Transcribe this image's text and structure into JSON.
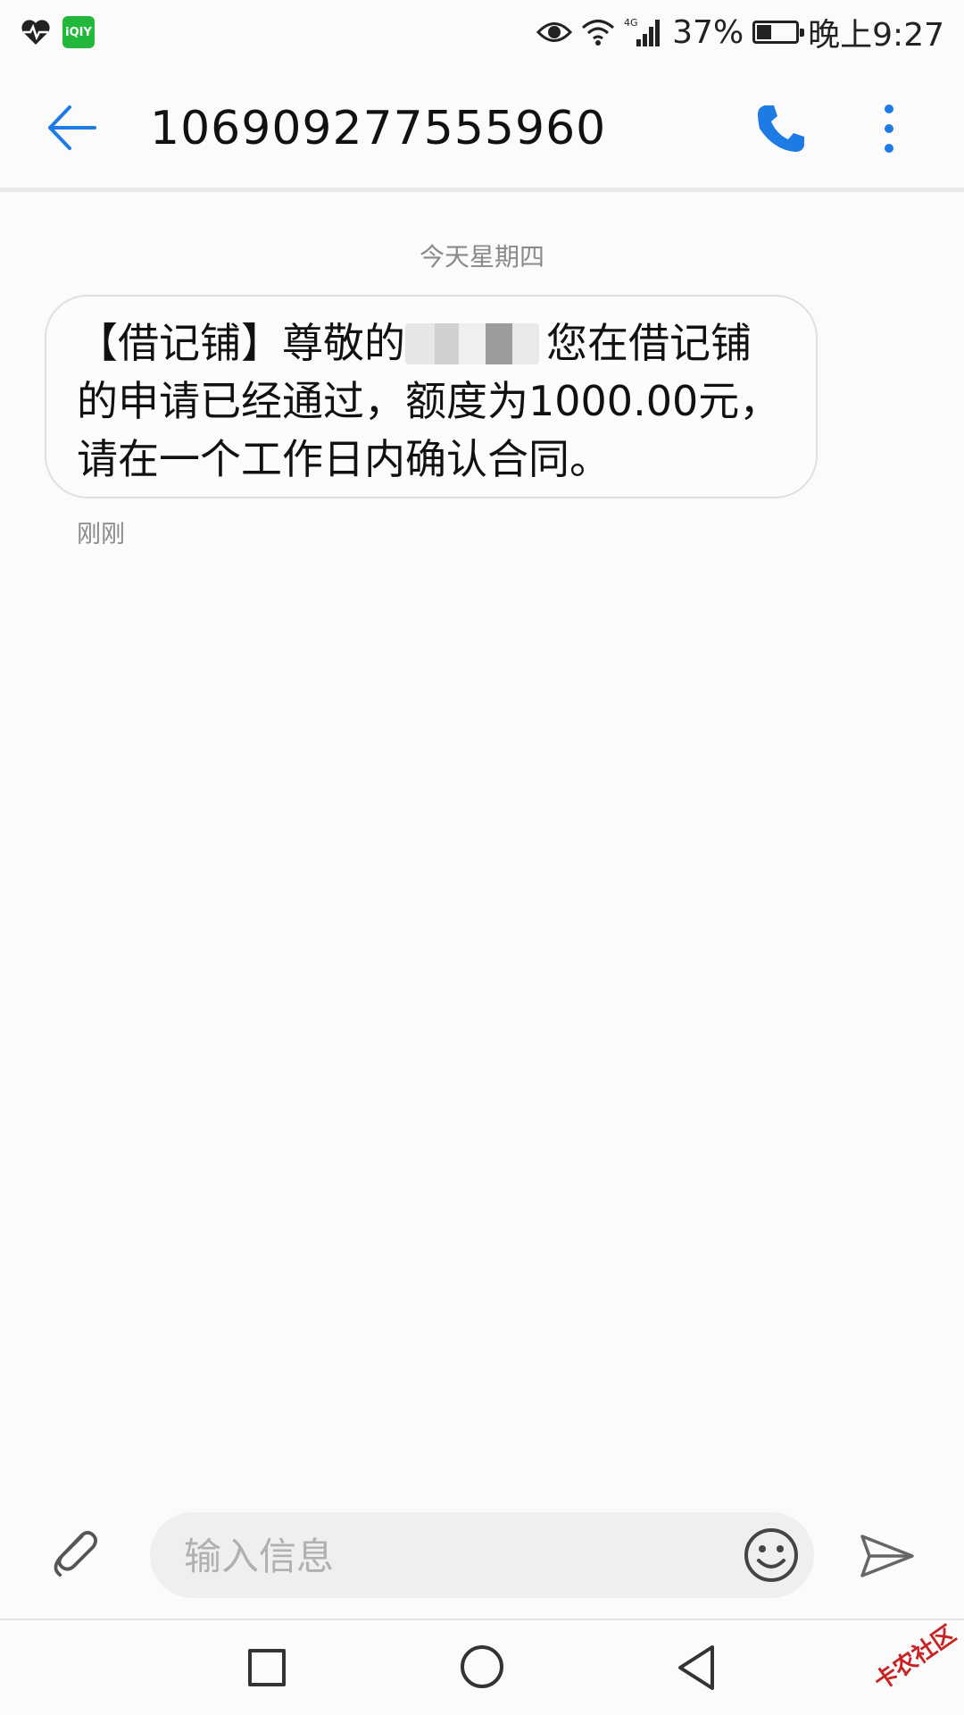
{
  "status_bar": {
    "iqiyi_label": "iQIY",
    "icons": [
      "heart-pulse-icon",
      "iqiyi-icon",
      "eye-icon",
      "wifi-icon",
      "signal-4g-icon",
      "battery-icon"
    ],
    "network_label": "4G",
    "battery_text": "37%",
    "battery_level": 0.37,
    "time": "晚上9:27"
  },
  "toolbar": {
    "title": "106909277555960",
    "accent": "#1e7be6"
  },
  "conversation": {
    "date_separator": "今天星期四",
    "messages": [
      {
        "text_before": "【借记铺】尊敬的",
        "text_after": "您在借记铺的申请已经通过，额度为1000.00元，请在一个工作日内确认合同。",
        "time": "刚刚"
      }
    ]
  },
  "composer": {
    "placeholder": "输入信息"
  },
  "watermark": {
    "text": "卡农社区"
  }
}
